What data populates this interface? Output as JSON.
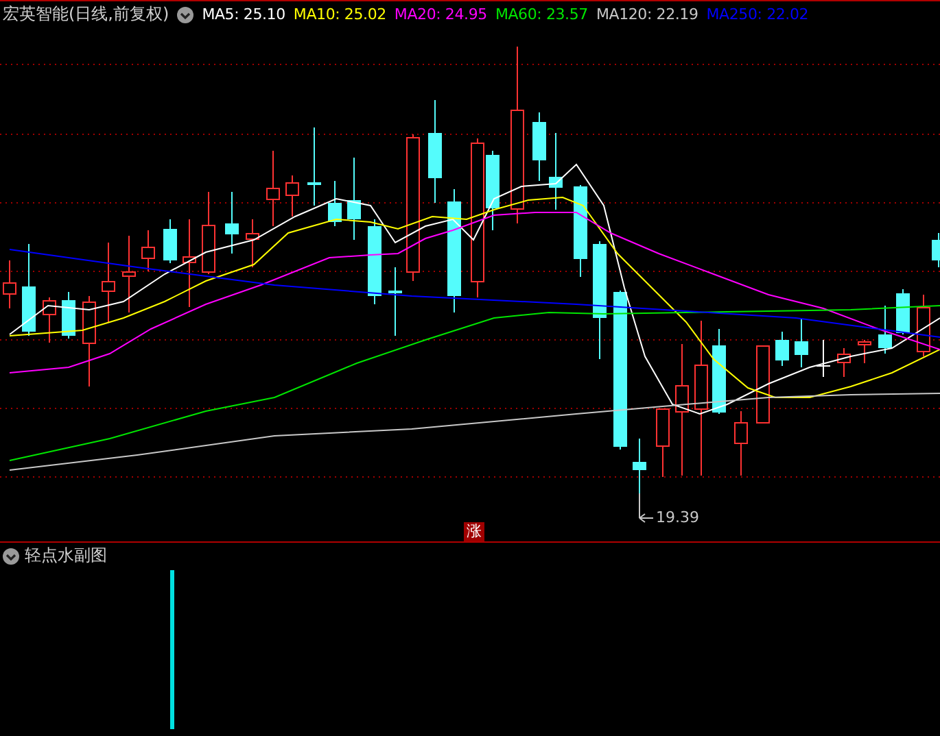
{
  "header": {
    "title": "宏英智能(日线,前复权)",
    "indicators": [
      {
        "label": "MA5: 25.10",
        "color": "#ffffff"
      },
      {
        "label": "MA10: 25.02",
        "color": "#ffff00"
      },
      {
        "label": "MA20: 24.95",
        "color": "#ff00ff"
      },
      {
        "label": "MA60: 23.57",
        "color": "#00e600"
      },
      {
        "label": "MA120: 22.19",
        "color": "#c8c8c8"
      },
      {
        "label": "MA250: 22.02",
        "color": "#0000ff"
      }
    ]
  },
  "main_chart": {
    "low_label": "19.39",
    "badge": "涨"
  },
  "sub_chart": {
    "title": "轻点水副图"
  }
}
